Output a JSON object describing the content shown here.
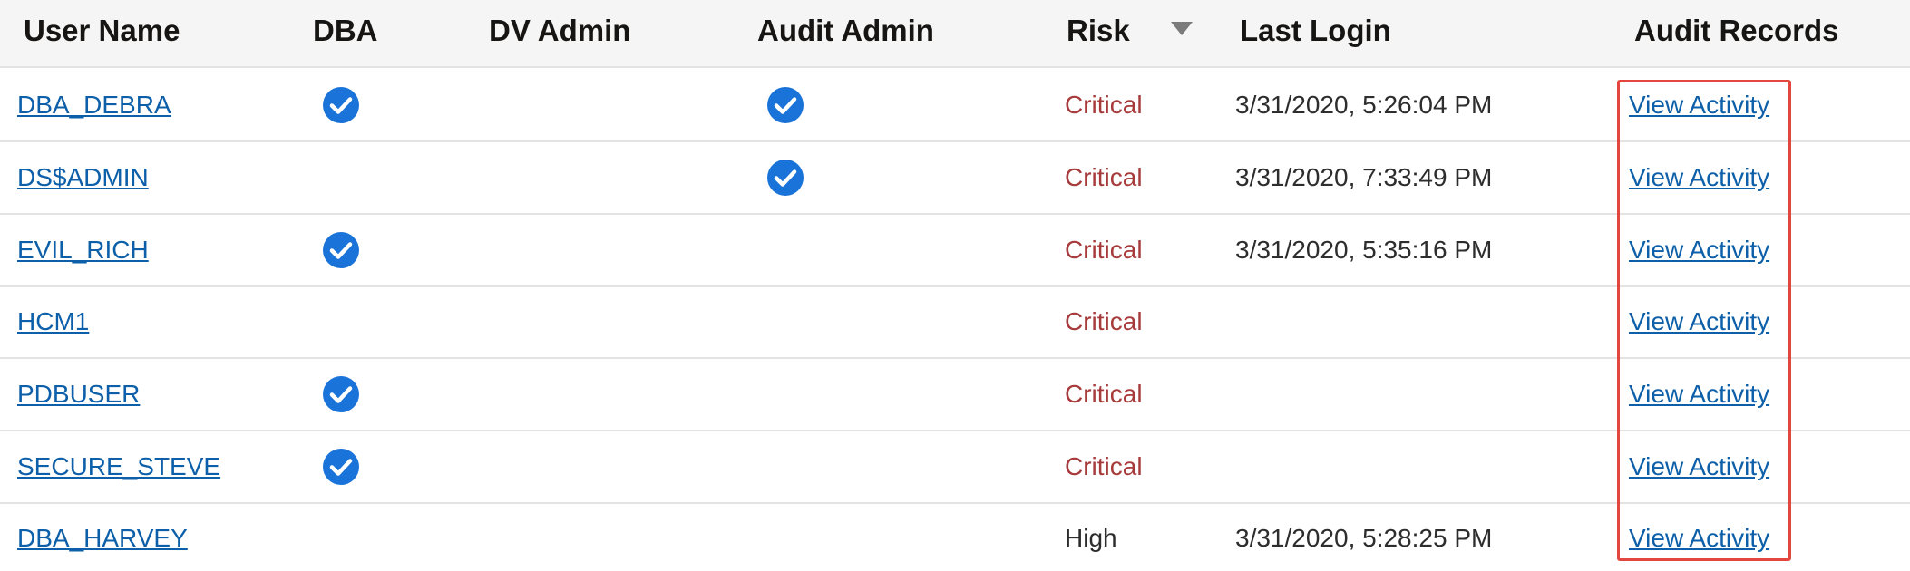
{
  "header": {
    "user_name": "User Name",
    "dba": "DBA",
    "dv_admin": "DV Admin",
    "audit_admin": "Audit Admin",
    "risk": "Risk",
    "last_login": "Last Login",
    "audit_records": "Audit Records",
    "sort_icon": "sort-descending-icon"
  },
  "rows": [
    {
      "user": "DBA_DEBRA",
      "dba": true,
      "dv_admin": false,
      "audit_admin": true,
      "risk": "Critical",
      "last_login": "3/31/2020, 5:26:04 PM",
      "audit": "View Activity"
    },
    {
      "user": "DS$ADMIN",
      "dba": false,
      "dv_admin": false,
      "audit_admin": true,
      "risk": "Critical",
      "last_login": "3/31/2020, 7:33:49 PM",
      "audit": "View Activity"
    },
    {
      "user": "EVIL_RICH",
      "dba": true,
      "dv_admin": false,
      "audit_admin": false,
      "risk": "Critical",
      "last_login": "3/31/2020, 5:35:16 PM",
      "audit": "View Activity"
    },
    {
      "user": "HCM1",
      "dba": false,
      "dv_admin": false,
      "audit_admin": false,
      "risk": "Critical",
      "last_login": "",
      "audit": "View Activity"
    },
    {
      "user": "PDBUSER",
      "dba": true,
      "dv_admin": false,
      "audit_admin": false,
      "risk": "Critical",
      "last_login": "",
      "audit": "View Activity"
    },
    {
      "user": "SECURE_STEVE",
      "dba": true,
      "dv_admin": false,
      "audit_admin": false,
      "risk": "Critical",
      "last_login": "",
      "audit": "View Activity"
    },
    {
      "user": "DBA_HARVEY",
      "dba": false,
      "dv_admin": false,
      "audit_admin": false,
      "risk": "High",
      "last_login": "3/31/2020, 5:28:25 PM",
      "audit": "View Activity"
    }
  ],
  "colors": {
    "link": "#0c5fa8",
    "critical": "#a73b3b",
    "check": "#1a73d9",
    "highlight": "#e2463e"
  }
}
